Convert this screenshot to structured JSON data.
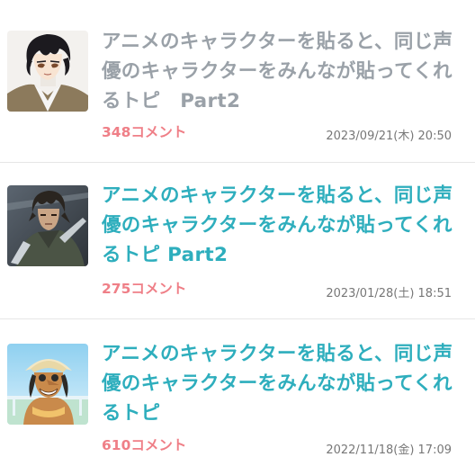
{
  "topics": [
    {
      "title": "アニメのキャラクターを貼ると、同じ声優のキャラクターをみんなが貼ってくれるトピ　Part2",
      "comments": "348コメント",
      "date": "2023/09/21(木) 20:50",
      "visited": true,
      "thumbnail": "anime-character-dark-hair-thumbnail"
    },
    {
      "title": "アニメのキャラクターを貼ると、同じ声優のキャラクターをみんなが貼ってくれるトピ Part2",
      "comments": "275コメント",
      "date": "2023/01/28(土) 18:51",
      "visited": false,
      "thumbnail": "anime-character-soldier-thumbnail"
    },
    {
      "title": "アニメのキャラクターを貼ると、同じ声優のキャラクターをみんなが貼ってくれるトピ",
      "comments": "610コメント",
      "date": "2022/11/18(金) 17:09",
      "visited": false,
      "thumbnail": "anime-character-sniper-thumbnail"
    }
  ],
  "colors": {
    "title_link": "#2eaebd",
    "title_visited": "#9aa1a8",
    "comment_count": "#ef7f87",
    "date": "#777777",
    "divider": "#e6e6e6"
  }
}
